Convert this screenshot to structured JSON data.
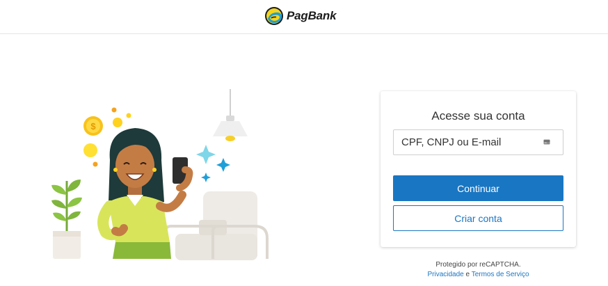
{
  "brand": {
    "name": "PagBank",
    "colors": {
      "yellow": "#f5d51b",
      "blue": "#1e9fd8",
      "dark": "#1c1c1c"
    }
  },
  "login": {
    "title": "Acesse sua conta",
    "input_placeholder": "CPF, CNPJ ou E-mail",
    "input_value": "",
    "input_icon": "card-icon",
    "continue_label": "Continuar",
    "create_label": "Criar conta"
  },
  "recaptcha": {
    "protected_text": "Protegido por reCAPTCHA.",
    "privacy_label": "Privacidade",
    "and_text": "e",
    "terms_label": "Termos de Serviço"
  },
  "illustration": {
    "name": "woman-with-phone-illustration",
    "coin_symbol": "$"
  },
  "colors": {
    "primary": "#1976c2",
    "border": "#cfcfcf",
    "text": "#333333"
  }
}
